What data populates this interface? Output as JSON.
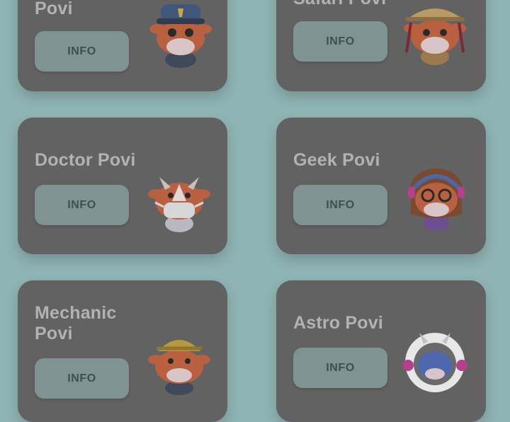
{
  "cards": [
    {
      "title": "Povi",
      "button": "INFO",
      "icon": "police-cow-icon"
    },
    {
      "title": "Safari Povi",
      "button": "INFO",
      "icon": "safari-cow-icon"
    },
    {
      "title": "Doctor Povi",
      "button": "INFO",
      "icon": "doctor-cow-icon"
    },
    {
      "title": "Geek Povi",
      "button": "INFO",
      "icon": "geek-cow-icon"
    },
    {
      "title": "Mechanic Povi",
      "button": "INFO",
      "icon": "mechanic-cow-icon"
    },
    {
      "title": "Astro Povi",
      "button": "INFO",
      "icon": "astro-cow-icon"
    }
  ],
  "colors": {
    "background": "#8fb4b4",
    "card": "#626262",
    "button": "#7f9393",
    "button_text": "#3e4f50",
    "title_text": "#b2b2b2",
    "mascot": "#b8603f"
  }
}
